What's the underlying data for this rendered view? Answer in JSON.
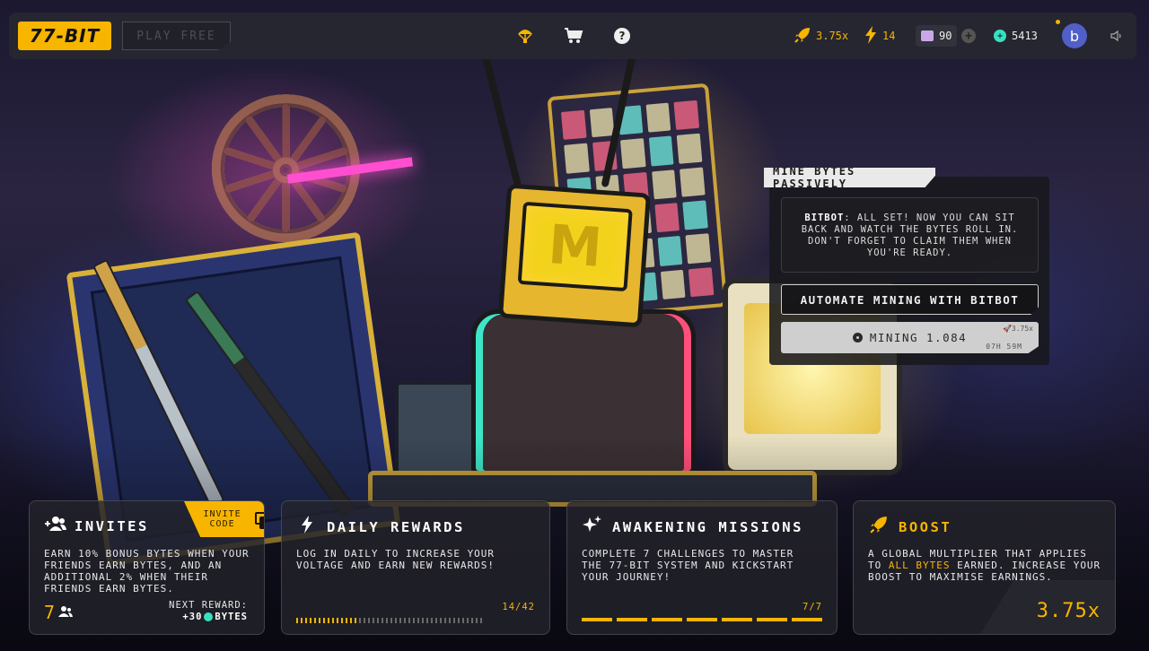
{
  "topbar": {
    "logo": "77-BIT",
    "play_free": "PLAY FREE",
    "stats": {
      "boost": "3.75x",
      "voltage": "14",
      "chips": "90",
      "bytes": "5413"
    },
    "avatar_initial": "b"
  },
  "mining": {
    "tag": "MINE BYTES PASSIVELY",
    "message_speaker": "BITBOT",
    "message_text": ": ALL SET! NOW YOU CAN SIT BACK AND WATCH THE BYTES ROLL IN. DON'T FORGET TO CLAIM THEM WHEN YOU'RE READY.",
    "automate_label": "AUTOMATE MINING WITH BITBOT",
    "mining_label": "MINING 1.084",
    "multiplier": "3.75x",
    "time_left": "07H 59M"
  },
  "cards": {
    "invites": {
      "title": "INVITES",
      "invite_code_label": "INVITE CODE",
      "description": "EARN 10% BONUS BYTES WHEN YOUR FRIENDS EARN BYTES, AND AN ADDITIONAL 2% WHEN THEIR FRIENDS EARN BYTES.",
      "count": "7",
      "next_reward_label": "NEXT REWARD:",
      "next_reward_prefix": "+30",
      "next_reward_unit": "BYTES"
    },
    "daily": {
      "title": "DAILY REWARDS",
      "description": "LOG IN DAILY TO INCREASE YOUR VOLTAGE AND EARN NEW REWARDS!",
      "progress_text": "14/42",
      "progress_done": 14,
      "progress_total": 42
    },
    "missions": {
      "title": "AWAKENING MISSIONS",
      "description": "COMPLETE 7 CHALLENGES TO MASTER THE 77-BIT SYSTEM AND KICKSTART YOUR JOURNEY!",
      "progress_text": "7/7",
      "progress_done": 7,
      "progress_total": 7
    },
    "boost": {
      "title": "BOOST",
      "description_pre": "A GLOBAL MULTIPLIER THAT APPLIES TO ",
      "description_hl": "ALL BYTES",
      "description_post": " EARNED. INCREASE YOUR BOOST TO MAXIMISE EARNINGS.",
      "value": "3.75x"
    }
  },
  "colors": {
    "accent": "#f7b500",
    "bytes_coin": "#38e0c0",
    "avatar": "#5060c8"
  },
  "icons": {
    "airdrop": "parachute-icon",
    "shop": "cart-icon",
    "help": "question-icon",
    "boost": "rocket-icon",
    "voltage": "lightning-icon",
    "chips": "chip-icon",
    "bytes": "byte-coin-icon",
    "sound": "speaker-icon",
    "invites": "people-plus-icon",
    "daily": "lightning-icon",
    "missions": "sparkle-icon"
  }
}
